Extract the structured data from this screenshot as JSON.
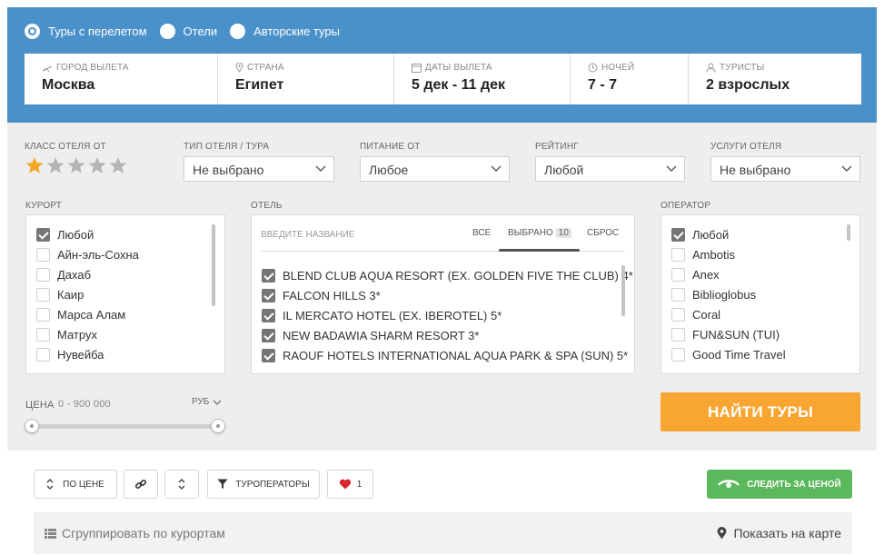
{
  "trip_types": [
    {
      "label": "Туры с перелетом",
      "checked": true
    },
    {
      "label": "Отели",
      "checked": false
    },
    {
      "label": "Авторские туры",
      "checked": false
    }
  ],
  "search": {
    "departure": {
      "caption": "ГОРОД ВЫЛЕТА",
      "value": "Москва",
      "icon": "plane-icon"
    },
    "country": {
      "caption": "СТРАНА",
      "value": "Египет",
      "icon": "map-pin-icon"
    },
    "dates": {
      "caption": "ДАТЫ ВЫЛЕТА",
      "value": "5 дек - 11 дек",
      "icon": "calendar-icon"
    },
    "nights": {
      "caption": "НОЧЕЙ",
      "value": "7 - 7",
      "icon": "moon-icon"
    },
    "tourists": {
      "caption": "ТУРИСТЫ",
      "value": "2 взрослых",
      "icon": "user-icon"
    }
  },
  "filters": {
    "hotel_class": {
      "label": "КЛАСС ОТЕЛЯ ОТ",
      "stars_total": 5,
      "stars_selected": 1
    },
    "hotel_type": {
      "label": "ТИП ОТЕЛЯ / ТУРА",
      "value": "Не выбрано"
    },
    "meal": {
      "label": "ПИТАНИЕ ОТ",
      "value": "Любое"
    },
    "rating": {
      "label": "РЕЙТИНГ",
      "value": "Любой"
    },
    "services": {
      "label": "УСЛУГИ ОТЕЛЯ",
      "value": "Не выбрано"
    },
    "resort": {
      "label": "КУРОРТ",
      "items": [
        {
          "label": "Любой",
          "checked": true
        },
        {
          "label": "Айн-эль-Сохна",
          "checked": false
        },
        {
          "label": "Дахаб",
          "checked": false
        },
        {
          "label": "Каир",
          "checked": false
        },
        {
          "label": "Марса Алам",
          "checked": false
        },
        {
          "label": "Матрух",
          "checked": false
        },
        {
          "label": "Нувейба",
          "checked": false
        }
      ]
    },
    "hotel": {
      "label": "ОТЕЛЬ",
      "placeholder": "ВВЕДИТЕ НАЗВАНИЕ",
      "tab_all": "ВСЕ",
      "tab_selected": "ВЫБРАНО",
      "selected_count": "10",
      "tab_reset": "СБРОС",
      "items": [
        {
          "label": "BLEND CLUB AQUA RESORT (EX. GOLDEN FIVE THE CLUB) 4*",
          "checked": true
        },
        {
          "label": "FALCON HILLS 3*",
          "checked": true
        },
        {
          "label": "IL MERCATO HOTEL (EX. IBEROTEL) 5*",
          "checked": true
        },
        {
          "label": "NEW BADAWIA SHARM RESORT 3*",
          "checked": true
        },
        {
          "label": "RAOUF HOTELS INTERNATIONAL AQUA PARK & SPA (SUN) 5*",
          "checked": true
        }
      ]
    },
    "operator": {
      "label": "ОПЕРАТОР",
      "items": [
        {
          "label": "Любой",
          "checked": true
        },
        {
          "label": "Ambotis",
          "checked": false
        },
        {
          "label": "Anex",
          "checked": false
        },
        {
          "label": "Biblioglobus",
          "checked": false
        },
        {
          "label": "Coral",
          "checked": false
        },
        {
          "label": "FUN&SUN (TUI)",
          "checked": false
        },
        {
          "label": "Good Time Travel",
          "checked": false
        }
      ]
    },
    "price": {
      "label": "ЦЕНА",
      "range": "0 - 900 000",
      "currency": "РУБ",
      "min_fraction": 0,
      "max_fraction": 1
    }
  },
  "find_button": "НАЙТИ ТУРЫ",
  "toolbar": {
    "sort_price": "ПО ЦЕНЕ",
    "operators": "ТУРОПЕРАТОРЫ",
    "favorites_count": "1",
    "watch_price": "СЛЕДИТЬ ЗА ЦЕНОЙ"
  },
  "group_bar": {
    "group_by_resort": "Сгруппировать по курортам",
    "show_on_map": "Показать на карте"
  },
  "colors": {
    "header_blue": "#4a90c9",
    "find_orange": "#f9a531",
    "watch_green": "#5cb85c",
    "star_active": "#f5a623",
    "star_inactive": "#b5b5b5",
    "heart_red": "#d9272e"
  }
}
